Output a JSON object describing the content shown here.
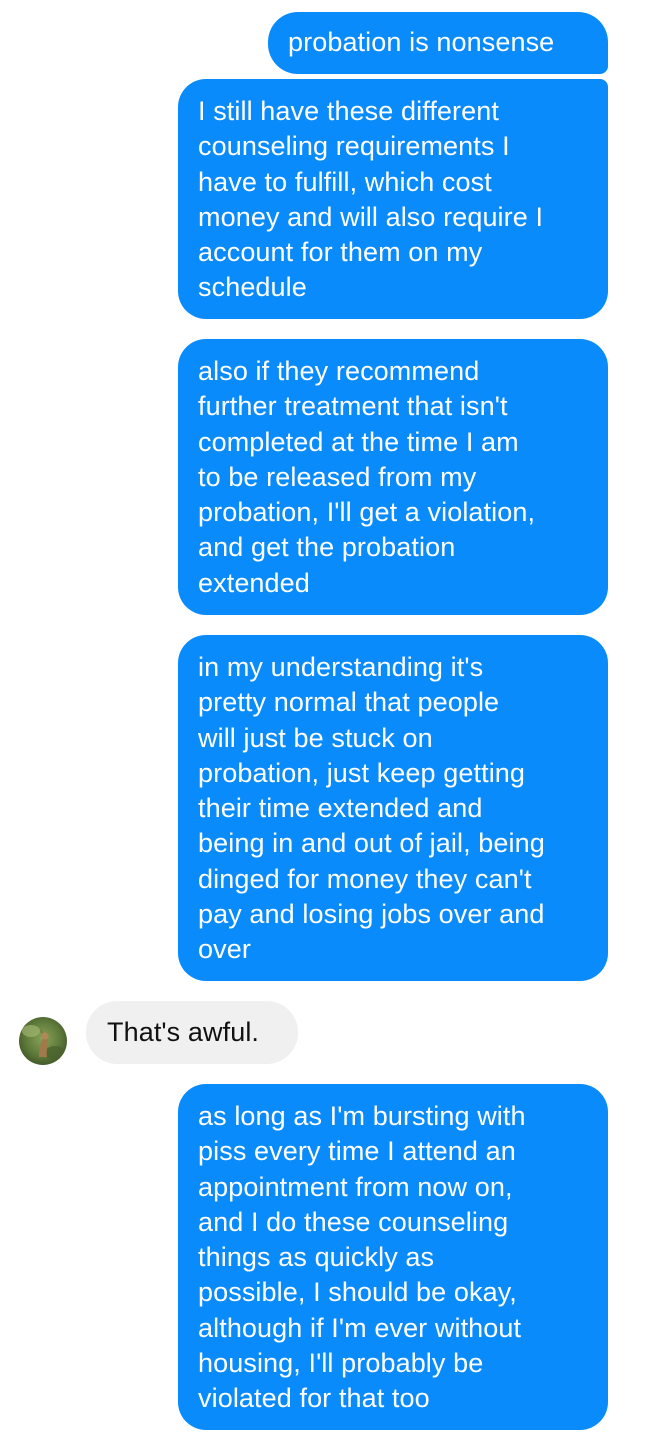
{
  "colors": {
    "outgoing_bubble": "#0a8bfc",
    "incoming_bubble": "#f0f0f0",
    "outgoing_text": "#ffffff",
    "incoming_text": "#111111",
    "background": "#ffffff"
  },
  "messages": [
    {
      "sender": "me",
      "text": "probation is nonsense"
    },
    {
      "sender": "me",
      "text": "I still have these different\ncounseling requirements I\nhave to fulfill, which cost\nmoney and will also require I\naccount for them on my\nschedule"
    },
    {
      "sender": "me",
      "text": "also if they recommend\nfurther treatment that isn't\ncompleted at the time I am\nto be released from my\nprobation, I'll get a violation,\nand get the probation\nextended"
    },
    {
      "sender": "me",
      "text": "in my understanding it's\npretty normal that people\nwill just be stuck on\nprobation, just keep getting\ntheir time extended and\nbeing in and out of jail, being\ndinged for money they can't\npay and losing jobs over and\nover"
    },
    {
      "sender": "contact",
      "text": "That's awful.",
      "avatar_icon": "contact-avatar-photo"
    },
    {
      "sender": "me",
      "text": "as long as I'm bursting with\npiss every time I attend an\nappointment from now on,\nand I do these counseling\nthings as quickly as\npossible, I should be okay,\nalthough if I'm ever without\nhousing, I'll probably be\nviolated for that too"
    }
  ]
}
